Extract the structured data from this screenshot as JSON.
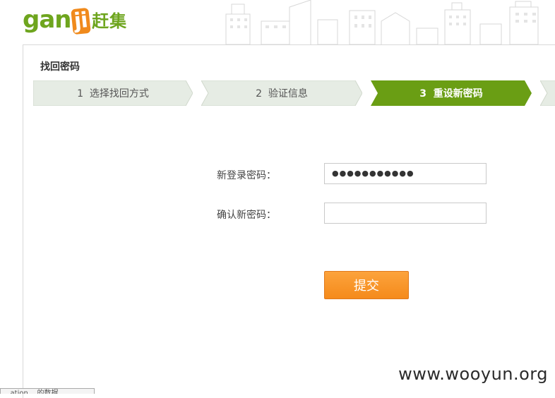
{
  "header": {
    "logo_latin_g": "gan",
    "logo_latin_ji": "ji",
    "logo_cn": "赶集"
  },
  "page": {
    "title": "找回密码"
  },
  "steps": [
    {
      "label": "1  选择找回方式",
      "state": "inactive"
    },
    {
      "label": "2  验证信息",
      "state": "inactive"
    },
    {
      "label": "3  重设新密码",
      "state": "active"
    }
  ],
  "form": {
    "new_password_label": "新登录密码：",
    "new_password_value": "●●●●●●●●●●●",
    "confirm_password_label": "确认新密码：",
    "confirm_password_value": "",
    "submit_label": "提交"
  },
  "colors": {
    "accent_green": "#6ea51e",
    "step_inactive": "#e6ece4",
    "step_active": "#6a9e14",
    "button_orange": "#f7921f"
  },
  "watermark": "www.wooyun.org",
  "status_tab_text": "...ation... 的数据"
}
